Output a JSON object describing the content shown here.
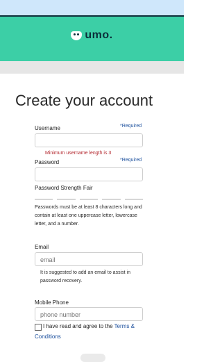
{
  "brand": {
    "logo_text": "umo",
    "logo_dot": "."
  },
  "page": {
    "title": "Create your account"
  },
  "form": {
    "username": {
      "label": "Username",
      "required": "*Required",
      "value": "",
      "error": "Minimum username length is 3"
    },
    "password": {
      "label": "Password",
      "required": "*Required",
      "value": "",
      "strength_text": "Password Strength Fair",
      "rules": [
        "Passwords must be at least 8 characters long and",
        "contain at least one uppercase letter, lowercase",
        "letter, and a number."
      ]
    },
    "email": {
      "label": "Email",
      "placeholder": "email",
      "hint": [
        "It is suggested to add an email to assist in",
        "password recovery."
      ]
    },
    "mobile": {
      "label": "Mobile Phone",
      "placeholder": "phone number"
    },
    "agree": {
      "text": "I have read and agree to the",
      "link_part1": "Terms &",
      "link_part2": "Conditions"
    }
  },
  "colors": {
    "header": "#3ccfa6",
    "top_strip": "#cfe7fb",
    "link": "#1a4e9c",
    "error": "#b3262d"
  }
}
